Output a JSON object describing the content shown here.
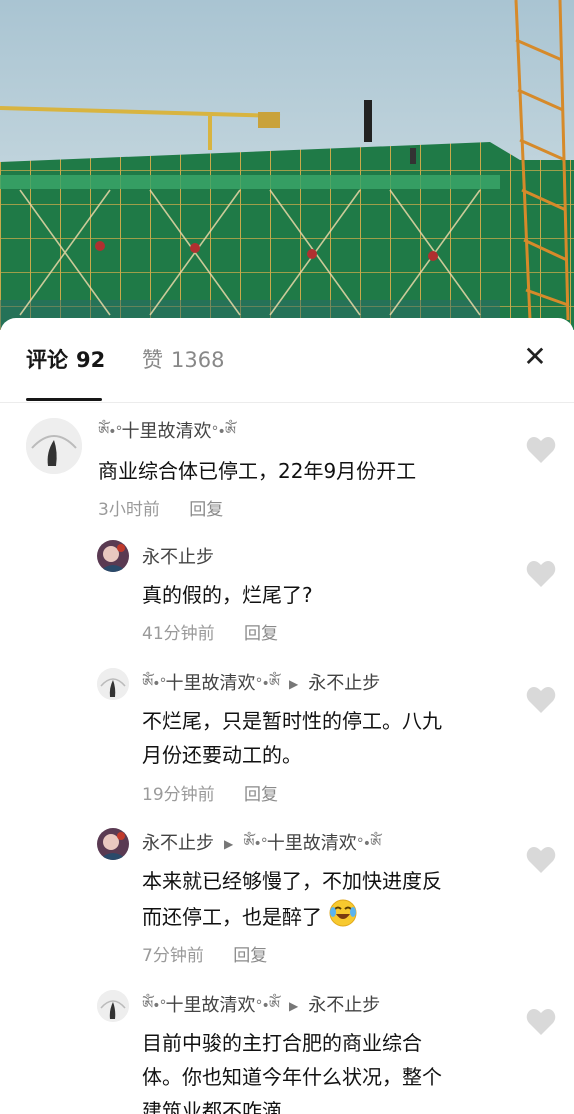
{
  "tabs": {
    "comments_label": "评论",
    "comments_count": "92",
    "likes_label": "赞",
    "likes_count": "1368"
  },
  "close_icon": "close-icon",
  "like_icon": "heart-icon",
  "comments": [
    {
      "user": "十里故清欢",
      "text": "商业综合体已停工，22年9月份开工",
      "time": "3小时前",
      "reply": "回复"
    },
    {
      "user": "永不止步",
      "text": "真的假的，烂尾了?",
      "time": "41分钟前",
      "reply": "回复"
    },
    {
      "user": "十里故清欢",
      "reply_to": "永不止步",
      "text_line1": "不烂尾，只是暂时性的停工。八九",
      "text_line2": "月份还要动工的。",
      "time": "19分钟前",
      "reply": "回复"
    },
    {
      "user": "永不止步",
      "reply_to": "十里故清欢",
      "text_line1": "本来就已经够慢了，不加快进度反",
      "text_line2": "而还停工，也是醉了",
      "emoji": "laughing-crying-emoji",
      "time": "7分钟前",
      "reply": "回复"
    },
    {
      "user": "十里故清欢",
      "reply_to": "永不止步",
      "text_line1": "目前中骏的主打合肥的商业综合",
      "text_line2": "体。你也知道今年什么状况，整个",
      "text_line3": "建筑业都不咋滴"
    }
  ],
  "decor": {
    "name_ornament_left": "ༀ•°",
    "name_ornament_right": "°•ༀ"
  }
}
